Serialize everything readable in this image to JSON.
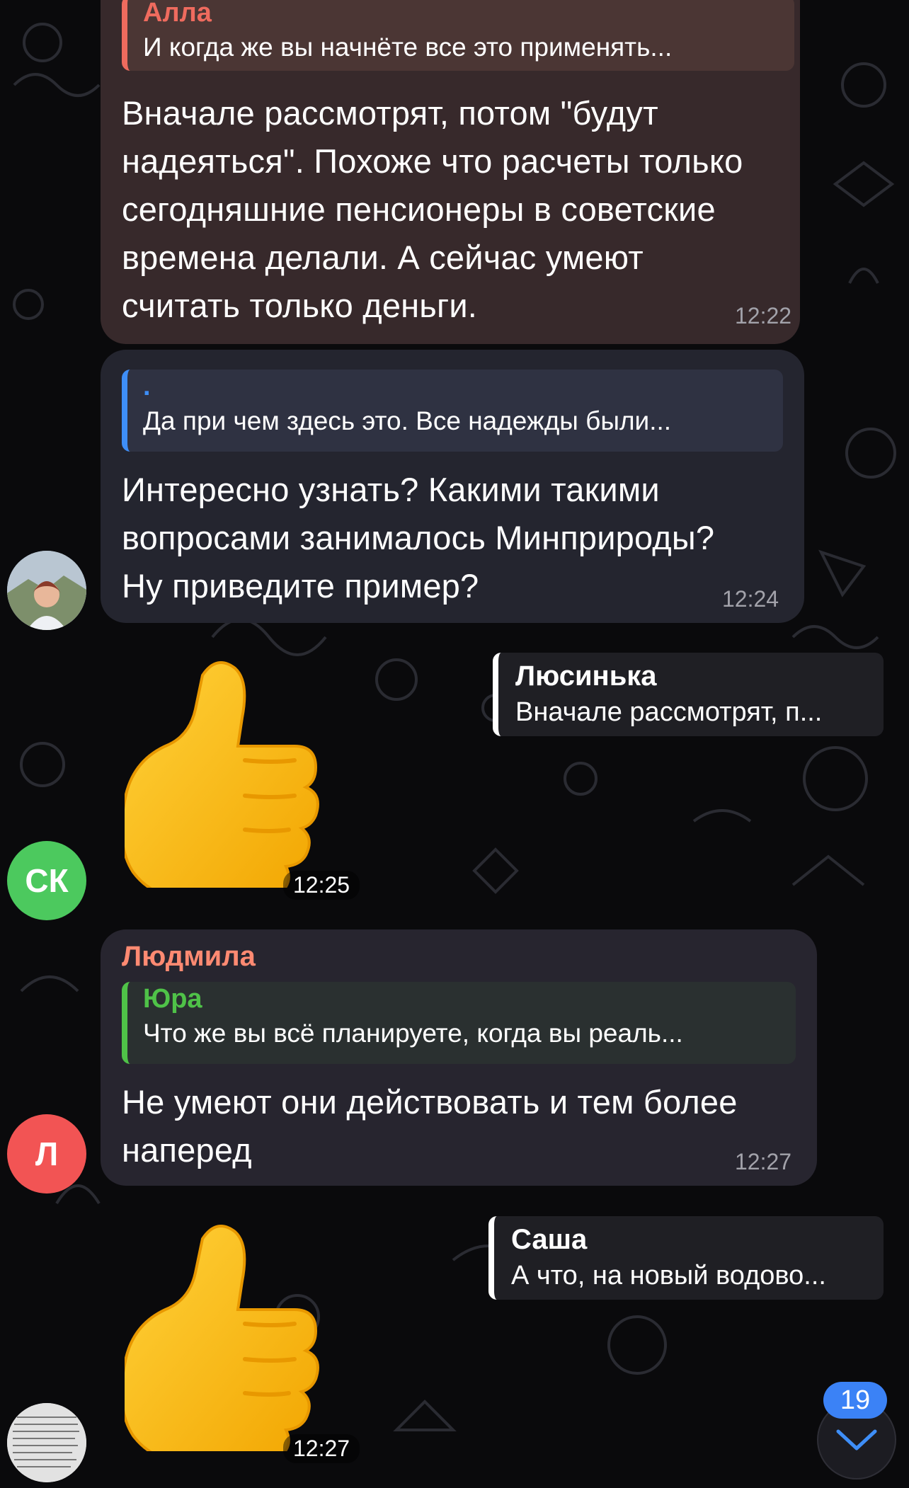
{
  "messages": [
    {
      "reply": {
        "name": "Алла",
        "text": "И когда же вы начнёте все это применять..."
      },
      "lines": [
        "Вначале рассмотрят, потом \"будут",
        "надеяться\". Похоже что расчеты только",
        "сегодняшние пенсионеры в советские",
        "времена делали. А сейчас умеют",
        "считать только деньги."
      ],
      "time": "12:22"
    },
    {
      "reply": {
        "name": ".",
        "text": "Да при чем здесь это. Все надежды были..."
      },
      "lines": [
        "Интересно узнать? Какими такими",
        "вопросами занималось Минприроды?",
        "Ну приведите пример?"
      ],
      "time": "12:24"
    },
    {
      "sender": "Людмила",
      "reply": {
        "name": "Юра",
        "text": "Что же вы всё планируете, когда вы реаль..."
      },
      "lines": [
        "Не умеют они действовать и тем более",
        "наперед"
      ],
      "time": "12:27"
    }
  ],
  "stickers": [
    {
      "emoji": "thumbs-up",
      "time": "12:25",
      "reply_name": "Люсинька",
      "reply_text": "Вначале рассмотрят, п..."
    },
    {
      "emoji": "thumbs-up",
      "time": "12:27",
      "reply_name": "Саша",
      "reply_text": "А что, на новый водово..."
    }
  ],
  "avatars": [
    {
      "initials": "",
      "type": "photo"
    },
    {
      "initials": "СК",
      "color": "#4cc95e"
    },
    {
      "initials": "Л",
      "color": "#f25454"
    },
    {
      "initials": "",
      "type": "photo-document"
    }
  ],
  "unread_badge": "19",
  "colors": {
    "alla_reply": "#ef6b5e",
    "dot_reply": "#3e8ef7",
    "ludmila_name": "#ff8a72",
    "yura_reply": "#4fc248"
  }
}
